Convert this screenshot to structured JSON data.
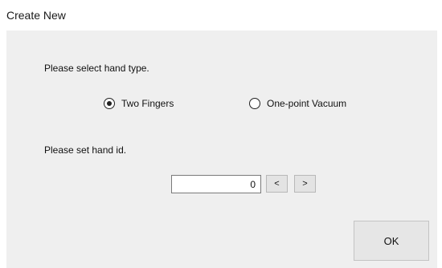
{
  "window": {
    "title": "Create New"
  },
  "hand_type": {
    "prompt": "Please select hand type.",
    "options": [
      {
        "label": "Two Fingers",
        "selected": true
      },
      {
        "label": "One-point Vacuum",
        "selected": false
      }
    ]
  },
  "hand_id": {
    "prompt": "Please set hand id.",
    "value": "0",
    "prev_label": "<",
    "next_label": ">"
  },
  "buttons": {
    "ok_label": "OK"
  }
}
